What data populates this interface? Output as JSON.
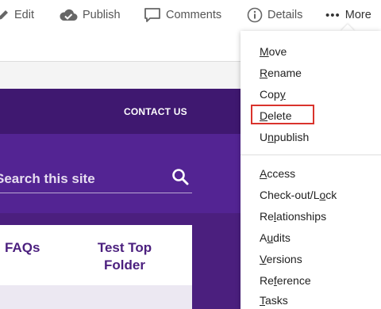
{
  "toolbar": {
    "edit": {
      "label": "Edit",
      "icon": "pencil-icon"
    },
    "publish": {
      "label": "Publish",
      "icon": "cloud-check-icon"
    },
    "comments": {
      "label": "Comments",
      "icon": "speech-bubble-icon"
    },
    "details": {
      "label": "Details",
      "icon": "info-circle-icon"
    },
    "more": {
      "label": "More",
      "icon": "ellipsis-icon",
      "dots": "•••"
    }
  },
  "site": {
    "nav_link": "CONTACT US",
    "search_placeholder": "Search this site",
    "cards": [
      {
        "label": "FAQs"
      },
      {
        "label": "Test Top Folder"
      }
    ],
    "colors": {
      "purple": "#4b1f7e",
      "purple_light": "#532493"
    }
  },
  "menu": {
    "group1": [
      {
        "pre": "",
        "u": "M",
        "post": "ove"
      },
      {
        "pre": "",
        "u": "R",
        "post": "ename"
      },
      {
        "pre": "Cop",
        "u": "y",
        "post": ""
      },
      {
        "pre": "",
        "u": "D",
        "post": "elete"
      },
      {
        "pre": "U",
        "u": "n",
        "post": "publish"
      }
    ],
    "group2": [
      {
        "pre": "",
        "u": "A",
        "post": "ccess"
      },
      {
        "pre": "Check-out/L",
        "u": "o",
        "post": "ck"
      },
      {
        "pre": "Re",
        "u": "l",
        "post": "ationships"
      },
      {
        "pre": "A",
        "u": "u",
        "post": "dits"
      },
      {
        "pre": "",
        "u": "V",
        "post": "ersions"
      },
      {
        "pre": "Re",
        "u": "f",
        "post": "erence"
      },
      {
        "pre": "",
        "u": "T",
        "post": "asks"
      }
    ],
    "highlight_color": "#d9332c"
  }
}
